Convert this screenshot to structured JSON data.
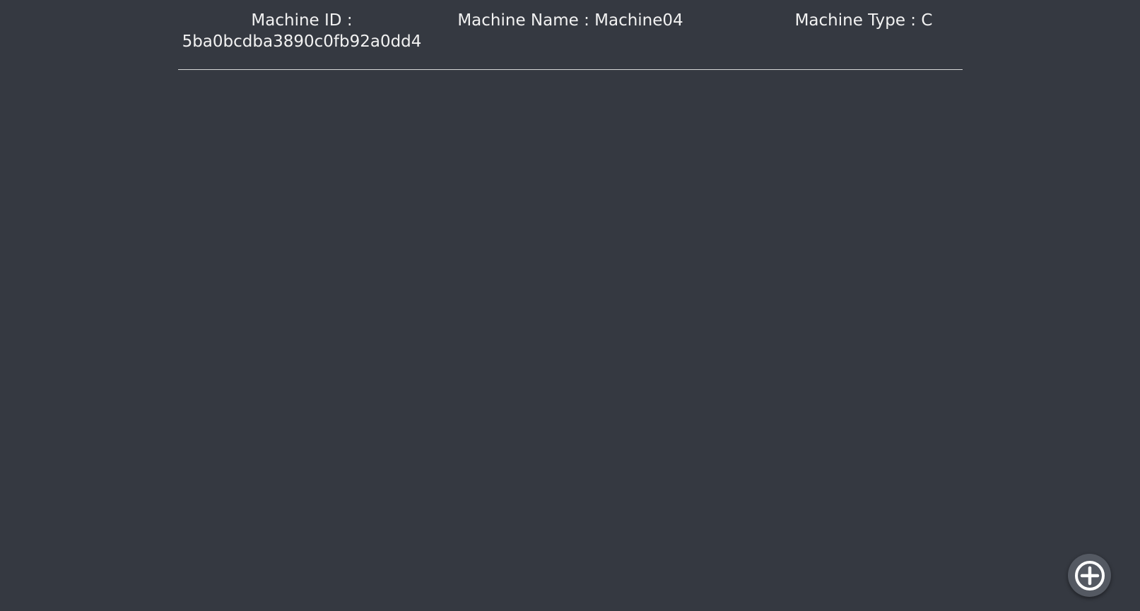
{
  "machine": {
    "id_label": "Machine ID :",
    "id_value": "5ba0bcdba3890c0fb92a0dd4",
    "name_text": "Machine Name : Machine04",
    "type_text": "Machine Type : C"
  },
  "fab": {
    "icon": "plus-circle-icon"
  },
  "colors": {
    "background": "#353941",
    "text": "#f2f2f2",
    "divider": "#d8d8d8",
    "fab": "#545962"
  }
}
